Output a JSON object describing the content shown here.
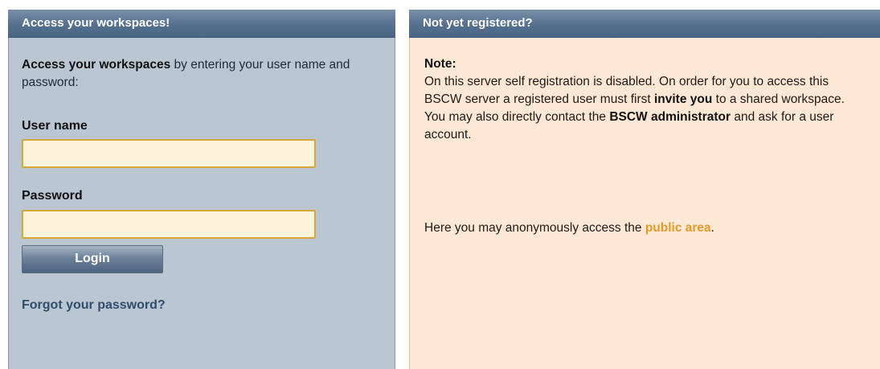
{
  "login_panel": {
    "header": "Access your workspaces!",
    "intro_bold": "Access your workspaces",
    "intro_rest": " by entering your user name and password:",
    "username_label": "User name",
    "username_value": "",
    "password_label": "Password",
    "password_value": "",
    "login_button": "Login",
    "forgot_link": "Forgot your password?"
  },
  "register_panel": {
    "header": "Not yet registered?",
    "note_title": "Note:",
    "note_text_1": "On this server self registration is disabled. On order for you to access this BSCW server a registered user must first ",
    "note_invite": "invite you",
    "note_text_2": " to a shared workspace. You may also directly contact the ",
    "note_admin": "BSCW administrator",
    "note_text_3": " and ask for a user account.",
    "public_prefix": "Here you may anonymously access the ",
    "public_link": "public area",
    "public_suffix": "."
  },
  "colors": {
    "login_panel_bg": "#bac6d2",
    "register_panel_bg": "#fde8d6",
    "header_bg": "#56708e",
    "input_border": "#d7a738",
    "link_orange": "#e39a2a",
    "link_blue": "#2f4d6c"
  }
}
